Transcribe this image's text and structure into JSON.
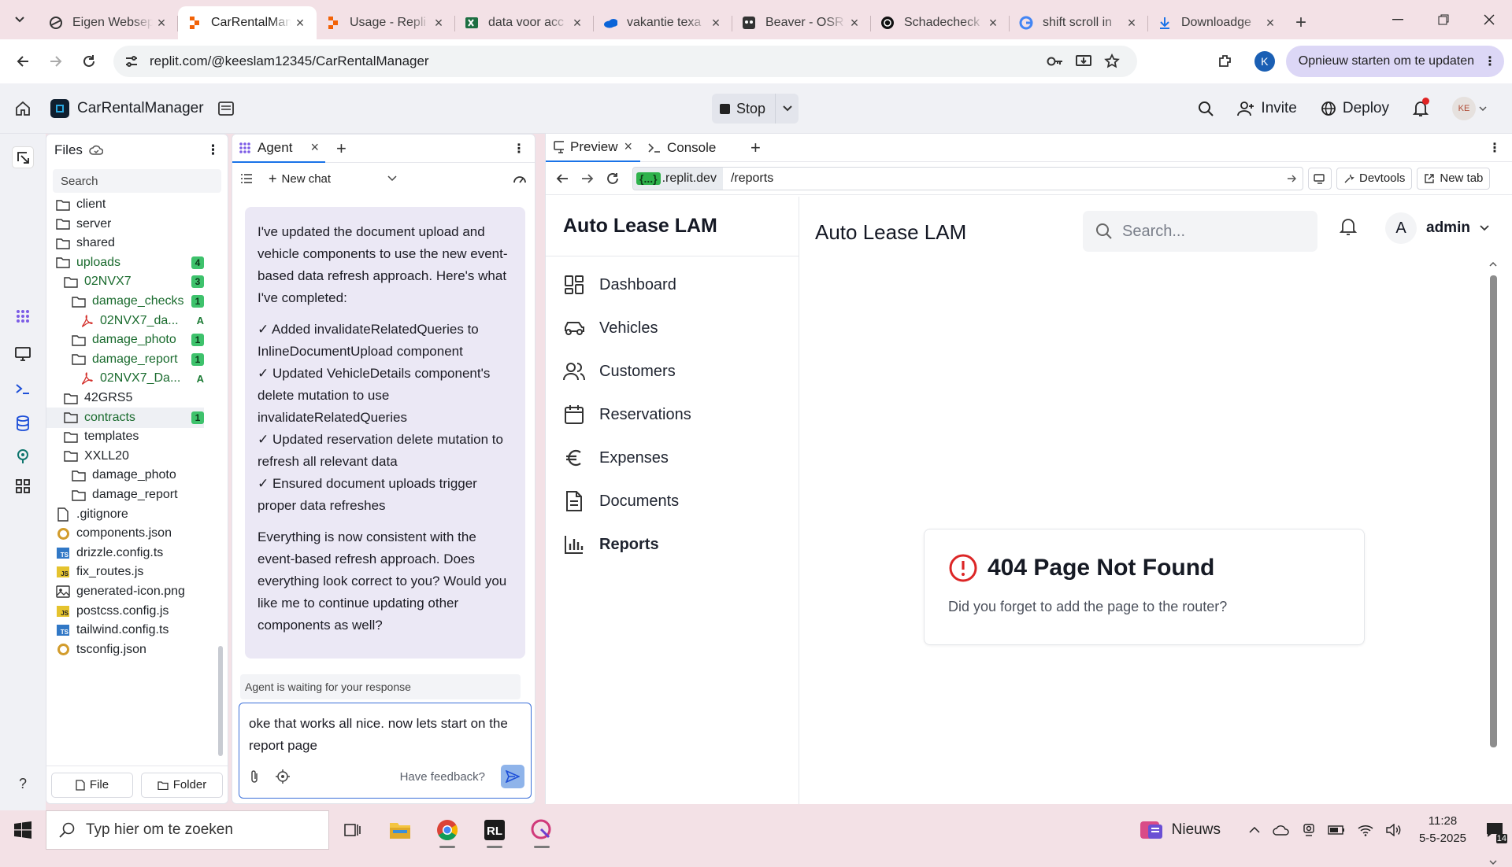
{
  "browser": {
    "tabs": [
      {
        "title": "Eigen Websep",
        "icon": "globe-icon"
      },
      {
        "title": "CarRentalMan",
        "icon": "replit-icon"
      },
      {
        "title": "Usage - Repli",
        "icon": "replit-icon"
      },
      {
        "title": "data voor acc",
        "icon": "excel-icon"
      },
      {
        "title": "vakantie texa",
        "icon": "onedrive-icon"
      },
      {
        "title": "Beaver - OSR",
        "icon": "beaver-icon"
      },
      {
        "title": "Schadecheck",
        "icon": "openai-icon"
      },
      {
        "title": "shift scroll in",
        "icon": "google-icon"
      },
      {
        "title": "Downloadge",
        "icon": "download-icon"
      }
    ],
    "url": "replit.com/@keeslam12345/CarRentalManager",
    "profile_letter": "K",
    "update_label": "Opnieuw starten om te updaten"
  },
  "replit": {
    "app_name": "CarRentalManager",
    "stop_label": "Stop",
    "invite_label": "Invite",
    "deploy_label": "Deploy",
    "avatar_initials": "KE"
  },
  "files": {
    "title": "Files",
    "search_placeholder": "Search",
    "items": [
      {
        "name": "client",
        "type": "folder",
        "depth": 0
      },
      {
        "name": "server",
        "type": "folder",
        "depth": 0
      },
      {
        "name": "shared",
        "type": "folder",
        "depth": 0
      },
      {
        "name": "uploads",
        "type": "folder",
        "depth": 0,
        "badge": "4",
        "color": "green"
      },
      {
        "name": "02NVX7",
        "type": "folder",
        "depth": 1,
        "badge": "3",
        "color": "green"
      },
      {
        "name": "damage_checks",
        "type": "folder",
        "depth": 2,
        "badge": "1",
        "color": "green"
      },
      {
        "name": "02NVX7_da...",
        "type": "pdf",
        "depth": 3,
        "flag": "A",
        "color": "green"
      },
      {
        "name": "damage_photo",
        "type": "folder",
        "depth": 2,
        "badge": "1",
        "color": "green"
      },
      {
        "name": "damage_report",
        "type": "folder",
        "depth": 2,
        "badge": "1",
        "color": "green"
      },
      {
        "name": "02NVX7_Da...",
        "type": "pdf",
        "depth": 3,
        "flag": "A",
        "color": "green"
      },
      {
        "name": "42GRS5",
        "type": "folder",
        "depth": 1
      },
      {
        "name": "contracts",
        "type": "folder",
        "depth": 1,
        "badge": "1",
        "color": "green"
      },
      {
        "name": "templates",
        "type": "folder",
        "depth": 1
      },
      {
        "name": "XXLL20",
        "type": "folder",
        "depth": 1
      },
      {
        "name": "damage_photo",
        "type": "folder",
        "depth": 2
      },
      {
        "name": "damage_report",
        "type": "folder",
        "depth": 2
      },
      {
        "name": ".gitignore",
        "type": "file",
        "depth": 0
      },
      {
        "name": "components.json",
        "type": "cfg",
        "depth": 0
      },
      {
        "name": "drizzle.config.ts",
        "type": "ts",
        "depth": 0
      },
      {
        "name": "fix_routes.js",
        "type": "js",
        "depth": 0
      },
      {
        "name": "generated-icon.png",
        "type": "img",
        "depth": 0
      },
      {
        "name": "postcss.config.js",
        "type": "js",
        "depth": 0
      },
      {
        "name": "tailwind.config.ts",
        "type": "ts",
        "depth": 0
      },
      {
        "name": "tsconfig.json",
        "type": "cfg",
        "depth": 0
      }
    ],
    "file_button": "File",
    "folder_button": "Folder"
  },
  "agent": {
    "tab_label": "Agent",
    "new_chat_label": "New chat",
    "message_paragraphs": [
      "I've updated the document upload and vehicle components to use the new event-based data refresh approach. Here's what I've completed:",
      "✓ Added invalidateRelatedQueries to InlineDocumentUpload component\n✓ Updated VehicleDetails component's delete mutation to use invalidateRelatedQueries\n✓ Updated reservation delete mutation to refresh all relevant data\n✓ Ensured document uploads trigger proper data refreshes",
      "Everything is now consistent with the event-based refresh approach. Does everything look correct to you? Would you like me to continue updating other components as well?"
    ],
    "waiting_text": "Agent is waiting for your response",
    "input_text": "oke that works all nice. now lets start on the report page",
    "feedback_label": "Have feedback?"
  },
  "preview": {
    "tab_label": "Preview",
    "console_label": "Console",
    "domain_chip": "{...}",
    "domain": ".replit.dev",
    "path": "/reports",
    "devtools_label": "Devtools",
    "newtab_label": "New tab"
  },
  "app": {
    "logo": "Auto Lease LAM",
    "title": "Auto Lease LAM",
    "search_placeholder": "Search...",
    "user_initial": "A",
    "user_name": "admin",
    "nav": [
      {
        "label": "Dashboard",
        "icon": "dashboard-icon"
      },
      {
        "label": "Vehicles",
        "icon": "car-icon"
      },
      {
        "label": "Customers",
        "icon": "users-icon"
      },
      {
        "label": "Reservations",
        "icon": "calendar-icon"
      },
      {
        "label": "Expenses",
        "icon": "euro-icon"
      },
      {
        "label": "Documents",
        "icon": "document-icon"
      },
      {
        "label": "Reports",
        "icon": "bar-chart-icon"
      }
    ],
    "not_found_title": "404 Page Not Found",
    "not_found_desc": "Did you forget to add the page to the router?"
  },
  "taskbar": {
    "search_placeholder": "Typ hier om te zoeken",
    "news_label": "Nieuws",
    "time": "11:28",
    "date": "5-5-2025",
    "notification_count": "14"
  }
}
